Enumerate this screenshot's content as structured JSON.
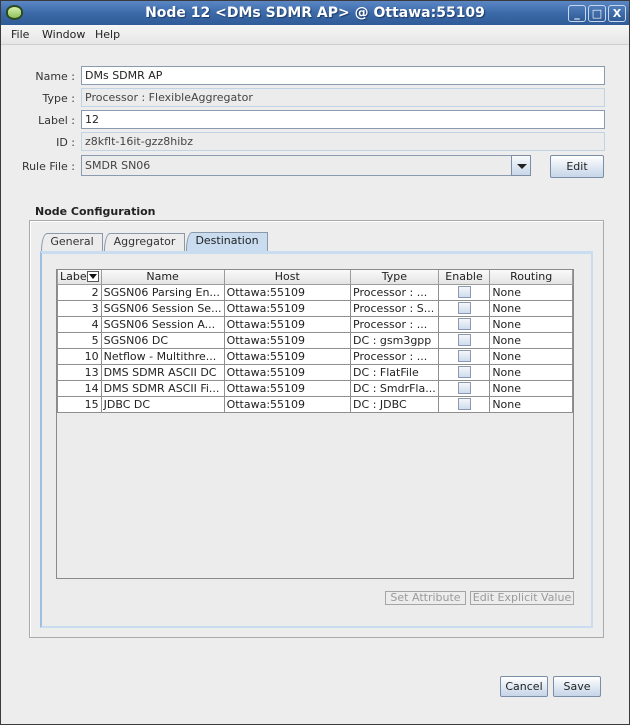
{
  "window": {
    "title": "Node 12 <DMs SDMR AP> @ Ottawa:55109",
    "controls": {
      "minimize": "_",
      "maximize": "□",
      "close": "X"
    }
  },
  "menubar": {
    "items": [
      "File",
      "Window",
      "Help"
    ]
  },
  "form": {
    "name": {
      "label": "Name :",
      "value": "DMs SDMR AP"
    },
    "type": {
      "label": "Type :",
      "value": "Processor : FlexibleAggregator"
    },
    "node_label": {
      "label": "Label :",
      "value": "12"
    },
    "id": {
      "label": "ID :",
      "value": "z8kflt-16it-gzz8hibz"
    },
    "rule_file": {
      "label": "Rule File :",
      "value": "SMDR SN06"
    },
    "edit_button": "Edit"
  },
  "node_configuration": {
    "title": "Node Configuration",
    "tabs": [
      "General",
      "Aggregator",
      "Destination"
    ],
    "active_tab": "Destination",
    "table": {
      "columns": [
        "Label",
        "Name",
        "Host",
        "Type",
        "Enable",
        "Routing"
      ],
      "rows": [
        {
          "label": "2",
          "name": "SGSN06 Parsing En...",
          "host": "Ottawa:55109",
          "type": "Processor : ...",
          "enable": false,
          "routing": "None"
        },
        {
          "label": "3",
          "name": "SGSN06 Session Se...",
          "host": "Ottawa:55109",
          "type": "Processor : S...",
          "enable": false,
          "routing": "None"
        },
        {
          "label": "4",
          "name": "SGSN06 Session A...",
          "host": "Ottawa:55109",
          "type": "Processor : ...",
          "enable": false,
          "routing": "None"
        },
        {
          "label": "5",
          "name": "SGSN06 DC",
          "host": "Ottawa:55109",
          "type": "DC : gsm3gpp",
          "enable": false,
          "routing": "None"
        },
        {
          "label": "10",
          "name": "Netflow - Multithre...",
          "host": "Ottawa:55109",
          "type": "Processor : ...",
          "enable": false,
          "routing": "None"
        },
        {
          "label": "13",
          "name": "DMS SDMR ASCII DC",
          "host": "Ottawa:55109",
          "type": "DC : FlatFile",
          "enable": false,
          "routing": "None"
        },
        {
          "label": "14",
          "name": "DMS SDMR ASCII Fi...",
          "host": "Ottawa:55109",
          "type": "DC : SmdrFla...",
          "enable": false,
          "routing": "None"
        },
        {
          "label": "15",
          "name": "JDBC DC",
          "host": "Ottawa:55109",
          "type": "DC : JDBC",
          "enable": false,
          "routing": "None"
        }
      ]
    },
    "set_attribute_button": "Set Attribute",
    "edit_explicit_value_button": "Edit Explicit Value"
  },
  "footer": {
    "cancel_button": "Cancel",
    "save_button": "Save"
  }
}
